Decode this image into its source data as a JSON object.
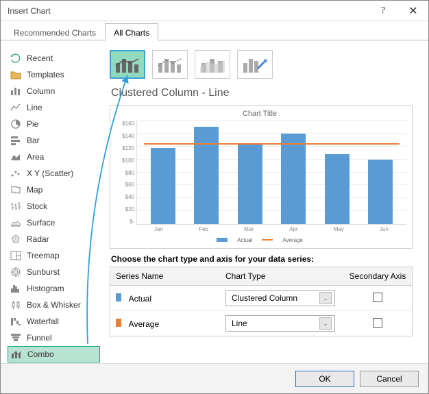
{
  "dialog": {
    "title": "Insert Chart"
  },
  "tabs": {
    "recommended": "Recommended Charts",
    "all": "All Charts"
  },
  "sidebar": {
    "items": [
      {
        "label": "Recent"
      },
      {
        "label": "Templates"
      },
      {
        "label": "Column"
      },
      {
        "label": "Line"
      },
      {
        "label": "Pie"
      },
      {
        "label": "Bar"
      },
      {
        "label": "Area"
      },
      {
        "label": "X Y (Scatter)"
      },
      {
        "label": "Map"
      },
      {
        "label": "Stock"
      },
      {
        "label": "Surface"
      },
      {
        "label": "Radar"
      },
      {
        "label": "Treemap"
      },
      {
        "label": "Sunburst"
      },
      {
        "label": "Histogram"
      },
      {
        "label": "Box & Whisker"
      },
      {
        "label": "Waterfall"
      },
      {
        "label": "Funnel"
      },
      {
        "label": "Combo"
      }
    ]
  },
  "main": {
    "title": "Clustered Column - Line"
  },
  "chart": {
    "title": "Chart Title",
    "yticks": [
      "$160",
      "$140",
      "$120",
      "$100",
      "$80",
      "$60",
      "$40",
      "$20",
      "$-"
    ],
    "categories": [
      "Jan",
      "Feb",
      "Mar",
      "Apr",
      "May",
      "Jun"
    ],
    "legend": {
      "actual": "Actual",
      "average": "Average"
    }
  },
  "series_section": {
    "prompt": "Choose the chart type and axis for your data series:",
    "headers": {
      "name": "Series Name",
      "type": "Chart Type",
      "axis": "Secondary Axis"
    },
    "rows": [
      {
        "name": "Actual",
        "type": "Clustered Column"
      },
      {
        "name": "Average",
        "type": "Line"
      }
    ]
  },
  "footer": {
    "ok": "OK",
    "cancel": "Cancel"
  },
  "chart_data": {
    "type": "combo",
    "title": "Chart Title",
    "categories": [
      "Jan",
      "Feb",
      "Mar",
      "Apr",
      "May",
      "Jun"
    ],
    "ylabel": "",
    "ylim": [
      0,
      160
    ],
    "yprefix": "$",
    "series": [
      {
        "name": "Actual",
        "type": "bar",
        "color": "#5b9bd5",
        "values": [
          118,
          150,
          123,
          140,
          108,
          100
        ]
      },
      {
        "name": "Average",
        "type": "line",
        "color": "#ed7d31",
        "values": [
          123,
          123,
          123,
          123,
          123,
          123
        ]
      }
    ]
  }
}
